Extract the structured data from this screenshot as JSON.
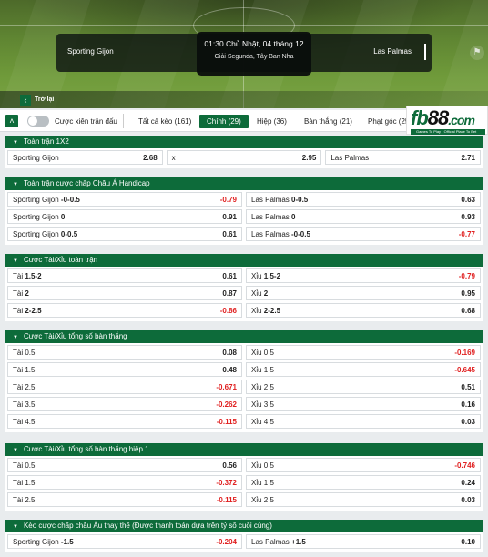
{
  "match": {
    "home": "Sporting Gijon",
    "away": "Las Palmas",
    "time": "01:30 Chủ Nhật, 04 tháng 12",
    "league": "Giải Segunda, Tây Ban Nha"
  },
  "nav": {
    "back_label": "Trở lại",
    "back_icon": "chevron-left-icon",
    "collapse_icon": "double-chevron-up-icon"
  },
  "filter": {
    "toggle_label": "Cược xiên trận đấu",
    "tabs": [
      {
        "label": "Tất cả kèo (161)",
        "active": false
      },
      {
        "label": "Chính (29)",
        "active": true
      },
      {
        "label": "Hiệp (36)",
        "active": false
      },
      {
        "label": "Bàn thắng (21)",
        "active": false
      },
      {
        "label": "Phạt góc (25",
        "active": false
      }
    ]
  },
  "logo": {
    "text_green": "fb",
    "text_dark": "88",
    "text_dom": ".com",
    "tagline": "Games To Play · Official Place To Bet"
  },
  "accent_color": "#0d6b3a",
  "negative_color": "#e02020",
  "sections": [
    {
      "title": "Toàn trận 1X2",
      "rows": [
        [
          {
            "label": "Sporting Gijon",
            "line": "",
            "odd": "2.68"
          },
          {
            "label": "x",
            "line": "",
            "odd": "2.95"
          },
          {
            "label": "Las Palmas",
            "line": "",
            "odd": "2.71"
          }
        ]
      ]
    },
    {
      "title": "Toàn trận cược chấp Châu Á Handicap",
      "rows": [
        [
          {
            "label": "Sporting Gijon",
            "line": "-0-0.5",
            "odd": "-0.79"
          },
          {
            "label": "Las Palmas",
            "line": "0-0.5",
            "odd": "0.63"
          }
        ],
        [
          {
            "label": "Sporting Gijon",
            "line": "0",
            "odd": "0.91"
          },
          {
            "label": "Las Palmas",
            "line": "0",
            "odd": "0.93"
          }
        ],
        [
          {
            "label": "Sporting Gijon",
            "line": "0-0.5",
            "odd": "0.61"
          },
          {
            "label": "Las Palmas",
            "line": "-0-0.5",
            "odd": "-0.77"
          }
        ]
      ]
    },
    {
      "title": "Cược Tài/Xỉu toàn trận",
      "rows": [
        [
          {
            "label": "Tài",
            "line": "1.5-2",
            "odd": "0.61"
          },
          {
            "label": "Xỉu",
            "line": "1.5-2",
            "odd": "-0.79"
          }
        ],
        [
          {
            "label": "Tài",
            "line": "2",
            "odd": "0.87"
          },
          {
            "label": "Xỉu",
            "line": "2",
            "odd": "0.95"
          }
        ],
        [
          {
            "label": "Tài",
            "line": "2-2.5",
            "odd": "-0.86"
          },
          {
            "label": "Xỉu",
            "line": "2-2.5",
            "odd": "0.68"
          }
        ]
      ]
    },
    {
      "title": "Cược Tài/Xỉu tổng số bàn thắng",
      "rows": [
        [
          {
            "label": "Tài 0.5",
            "line": "",
            "odd": "0.08"
          },
          {
            "label": "Xỉu 0.5",
            "line": "",
            "odd": "-0.169"
          }
        ],
        [
          {
            "label": "Tài 1.5",
            "line": "",
            "odd": "0.48"
          },
          {
            "label": "Xỉu 1.5",
            "line": "",
            "odd": "-0.645"
          }
        ],
        [
          {
            "label": "Tài 2.5",
            "line": "",
            "odd": "-0.671"
          },
          {
            "label": "Xỉu 2.5",
            "line": "",
            "odd": "0.51"
          }
        ],
        [
          {
            "label": "Tài 3.5",
            "line": "",
            "odd": "-0.262"
          },
          {
            "label": "Xỉu 3.5",
            "line": "",
            "odd": "0.16"
          }
        ],
        [
          {
            "label": "Tài 4.5",
            "line": "",
            "odd": "-0.115"
          },
          {
            "label": "Xỉu 4.5",
            "line": "",
            "odd": "0.03"
          }
        ]
      ]
    },
    {
      "title": "Cược Tài/Xỉu tổng số bàn thắng hiệp 1",
      "rows": [
        [
          {
            "label": "Tài 0.5",
            "line": "",
            "odd": "0.56"
          },
          {
            "label": "Xỉu 0.5",
            "line": "",
            "odd": "-0.746"
          }
        ],
        [
          {
            "label": "Tài 1.5",
            "line": "",
            "odd": "-0.372"
          },
          {
            "label": "Xỉu 1.5",
            "line": "",
            "odd": "0.24"
          }
        ],
        [
          {
            "label": "Tài 2.5",
            "line": "",
            "odd": "-0.115"
          },
          {
            "label": "Xỉu 2.5",
            "line": "",
            "odd": "0.03"
          }
        ]
      ]
    },
    {
      "title": "Kèo cược chấp châu Âu thay thế (Được thanh toán dựa trên tỷ số cuối cùng)",
      "rows": [
        [
          {
            "label": "Sporting Gijon",
            "line": "-1.5",
            "odd": "-0.204"
          },
          {
            "label": "Las Palmas",
            "line": "+1.5",
            "odd": "0.10"
          }
        ]
      ]
    }
  ]
}
